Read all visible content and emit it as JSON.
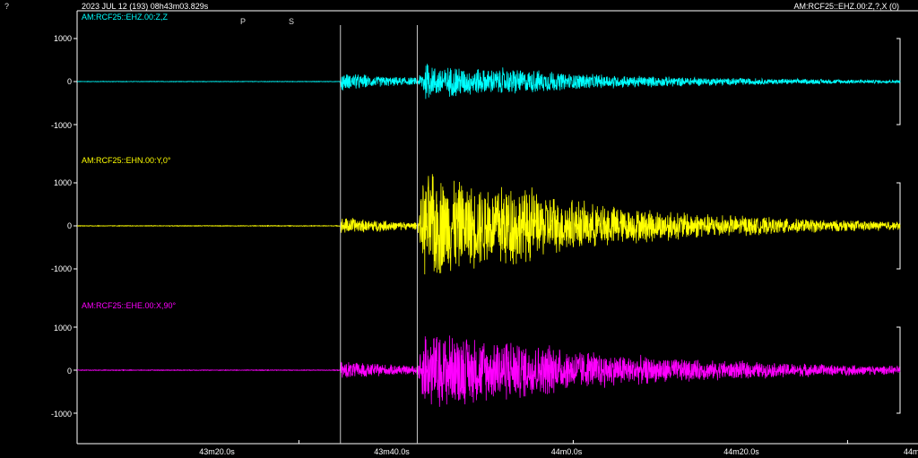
{
  "header": {
    "help_glyph": "?",
    "datetime": "2023 JUL 12 (193)  08h43m03.829s",
    "station_info": "AM:RCF25::EHZ.00:Z,?,X (0)"
  },
  "colors": {
    "background": "#000000",
    "axis": "#ffffff",
    "marker": "#c8c8c8"
  },
  "chart_data": {
    "type": "line",
    "time_axis": {
      "unit": "seconds after 08h43m03.829s",
      "range": [
        0,
        60
      ],
      "ticks": [
        {
          "t": 16.171,
          "label": "43m20.0s"
        },
        {
          "t": 36.171,
          "label": "43m40.0s"
        },
        {
          "t": 56.171,
          "label": "44m0.0s"
        },
        {
          "t": 76.171,
          "label": "44m20.0s"
        },
        {
          "t": 96.171,
          "label": "44m4"
        }
      ]
    },
    "phase_picks": [
      {
        "label": "P",
        "t": 19.2
      },
      {
        "label": "S",
        "t": 24.8
      }
    ],
    "series": [
      {
        "name": "AM:RCF25::EHZ.00:Z,Z",
        "color": "#00ffff",
        "ylim": [
          -1000,
          1000
        ],
        "yticks": [
          1000,
          0,
          -1000
        ],
        "noise": 6,
        "p_amp": 220,
        "s_amp": 420,
        "decay_s": 14
      },
      {
        "name": "AM:RCF25::EHN.00:Y,0°",
        "color": "#ffff00",
        "ylim": [
          -1000,
          1000
        ],
        "yticks": [
          1000,
          0,
          -1000
        ],
        "noise": 8,
        "p_amp": 220,
        "s_amp": 1450,
        "decay_s": 13
      },
      {
        "name": "AM:RCF25::EHE.00:X,90°",
        "color": "#ff00ff",
        "ylim": [
          -1000,
          1000
        ],
        "yticks": [
          1000,
          0,
          -1000
        ],
        "noise": 8,
        "p_amp": 240,
        "s_amp": 1020,
        "decay_s": 15
      }
    ]
  }
}
